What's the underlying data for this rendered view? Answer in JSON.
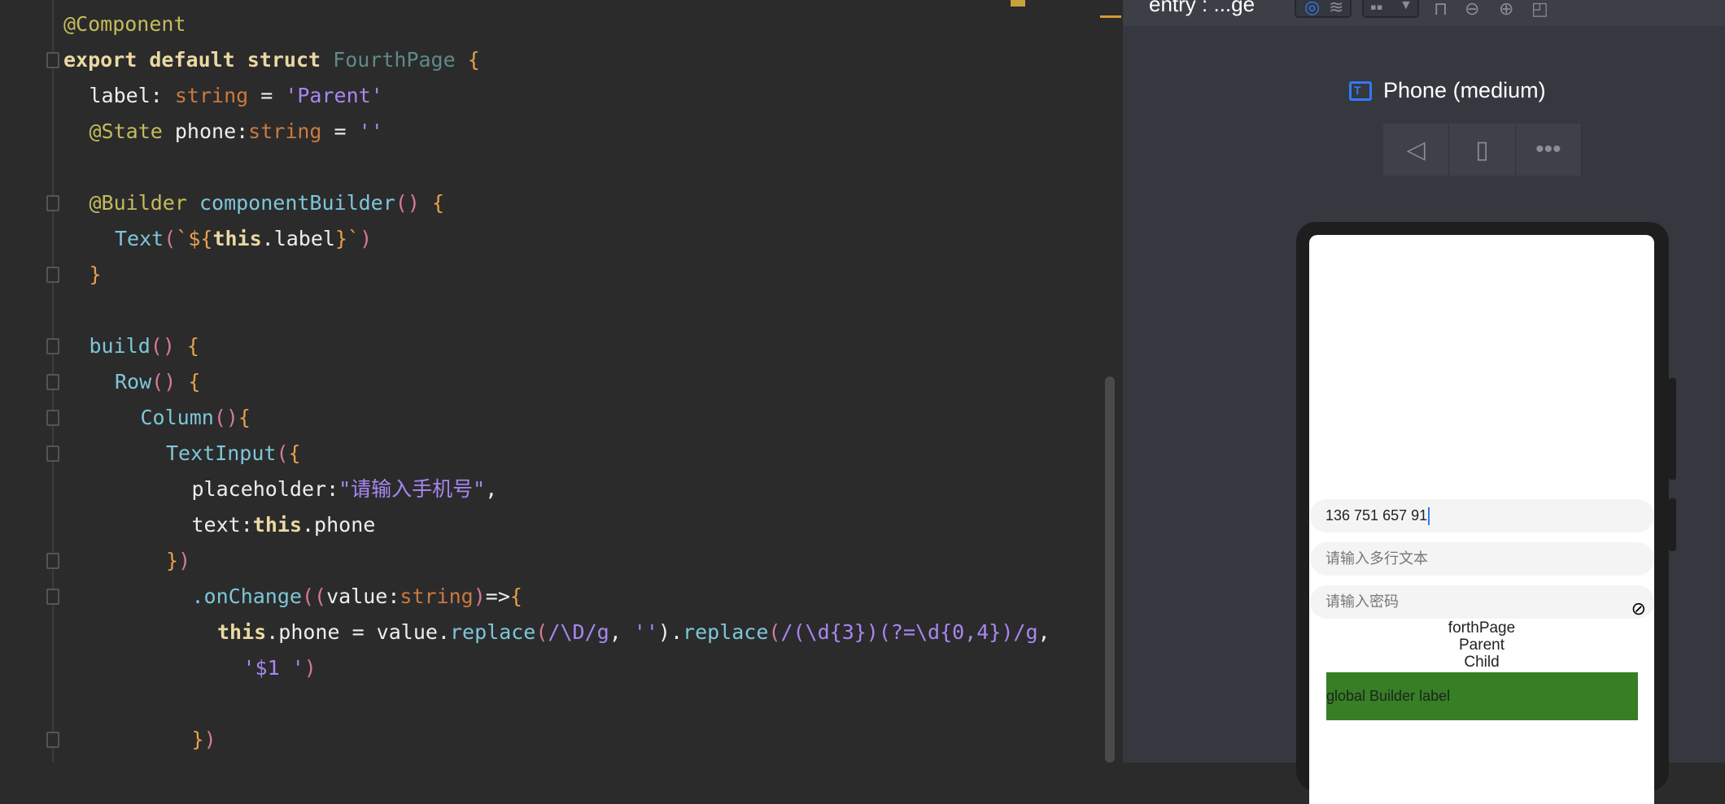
{
  "editor": {
    "lines": [
      {
        "indent": 0,
        "fold": "",
        "tokens": [
          [
            "@Component",
            "ann"
          ]
        ]
      },
      {
        "indent": 0,
        "fold": "open",
        "tokens": [
          [
            "export default struct ",
            "kw"
          ],
          [
            "FourthPage ",
            "cls"
          ],
          [
            "{",
            "brace"
          ]
        ]
      },
      {
        "indent": 1,
        "fold": "",
        "tokens": [
          [
            "label: ",
            "id"
          ],
          [
            "string",
            "type"
          ],
          [
            " = ",
            "id"
          ],
          [
            "'Parent'",
            "str"
          ]
        ]
      },
      {
        "indent": 1,
        "fold": "",
        "tokens": [
          [
            "@State ",
            "ann"
          ],
          [
            "phone:",
            "id"
          ],
          [
            "string",
            "type"
          ],
          [
            " = ",
            "id"
          ],
          [
            "''",
            "str"
          ]
        ]
      },
      {
        "indent": 0,
        "fold": "",
        "tokens": []
      },
      {
        "indent": 1,
        "fold": "open",
        "tokens": [
          [
            "@Builder ",
            "ann"
          ],
          [
            "componentBuilder",
            "fn"
          ],
          [
            "() ",
            "paren"
          ],
          [
            "{",
            "brace"
          ]
        ]
      },
      {
        "indent": 2,
        "fold": "",
        "tokens": [
          [
            "Text",
            "fn"
          ],
          [
            "(",
            "paren"
          ],
          [
            "`${",
            "brace"
          ],
          [
            "this",
            "this"
          ],
          [
            ".label",
            "id"
          ],
          [
            "}`",
            "brace"
          ],
          [
            ")",
            "paren"
          ]
        ]
      },
      {
        "indent": 1,
        "fold": "close",
        "tokens": [
          [
            "}",
            "brace"
          ]
        ]
      },
      {
        "indent": 0,
        "fold": "",
        "tokens": []
      },
      {
        "indent": 1,
        "fold": "open",
        "tokens": [
          [
            "build",
            "fn"
          ],
          [
            "() ",
            "paren"
          ],
          [
            "{",
            "brace"
          ]
        ]
      },
      {
        "indent": 2,
        "fold": "open",
        "tokens": [
          [
            "Row",
            "fn"
          ],
          [
            "() ",
            "paren"
          ],
          [
            "{",
            "brace"
          ]
        ]
      },
      {
        "indent": 3,
        "fold": "open",
        "tokens": [
          [
            "Column",
            "fn"
          ],
          [
            "()",
            "paren"
          ],
          [
            "{",
            "brace"
          ]
        ]
      },
      {
        "indent": 4,
        "fold": "open",
        "tokens": [
          [
            "TextInput",
            "fn"
          ],
          [
            "(",
            "paren"
          ],
          [
            "{",
            "brace"
          ]
        ]
      },
      {
        "indent": 5,
        "fold": "",
        "tokens": [
          [
            "placeholder:",
            "id"
          ],
          [
            "\"请输入手机号\"",
            "str"
          ],
          [
            ",",
            "id"
          ]
        ]
      },
      {
        "indent": 5,
        "fold": "",
        "tokens": [
          [
            "text:",
            "id"
          ],
          [
            "this",
            "this"
          ],
          [
            ".phone",
            "id"
          ]
        ]
      },
      {
        "indent": 4,
        "fold": "close",
        "tokens": [
          [
            "}",
            "brace"
          ],
          [
            ")",
            "paren"
          ]
        ]
      },
      {
        "indent": 5,
        "fold": "open",
        "tokens": [
          [
            ".onChange",
            "fn"
          ],
          [
            "((",
            "paren"
          ],
          [
            "value:",
            "id"
          ],
          [
            "string",
            "type"
          ],
          [
            ")",
            "paren"
          ],
          [
            "=>",
            "id"
          ],
          [
            "{",
            "brace"
          ]
        ]
      },
      {
        "indent": 6,
        "fold": "",
        "tokens": [
          [
            "this",
            "this"
          ],
          [
            ".phone = value.",
            "id"
          ],
          [
            "replace",
            "fn"
          ],
          [
            "(",
            "paren"
          ],
          [
            "/\\D/g",
            "str"
          ],
          [
            ", ",
            "id"
          ],
          [
            "''",
            "str"
          ],
          [
            ").",
            "id"
          ],
          [
            "replace",
            "fn"
          ],
          [
            "(",
            "paren"
          ],
          [
            "/(\\d{3})(?=\\d{0,4})/g",
            "str"
          ],
          [
            ",",
            "id"
          ]
        ]
      },
      {
        "indent": 7,
        "fold": "",
        "tokens": [
          [
            "'$1 '",
            "str"
          ],
          [
            ")",
            "paren"
          ]
        ]
      },
      {
        "indent": 0,
        "fold": "",
        "tokens": []
      },
      {
        "indent": 5,
        "fold": "close",
        "tokens": [
          [
            "}",
            "brace"
          ],
          [
            ")",
            "paren"
          ]
        ]
      }
    ]
  },
  "preview": {
    "title": "entry : ...ge",
    "device": "Phone (medium)",
    "device_icon_letter": "T",
    "controls": [
      "back-icon",
      "rotate-icon",
      "more-icon"
    ],
    "app": {
      "phone_value": "136 751 657 91",
      "multiline_placeholder": "请输入多行文本",
      "password_placeholder": "请输入密码",
      "texts": [
        "forthPage",
        "Parent",
        "Child"
      ],
      "builder_label": "global Builder label",
      "builder_bg": "#367f24"
    }
  },
  "colors": {
    "accent": "#2f7cf6",
    "annotation": "#c4bb5a",
    "string": "#a887f0",
    "function": "#7ec6d8"
  }
}
